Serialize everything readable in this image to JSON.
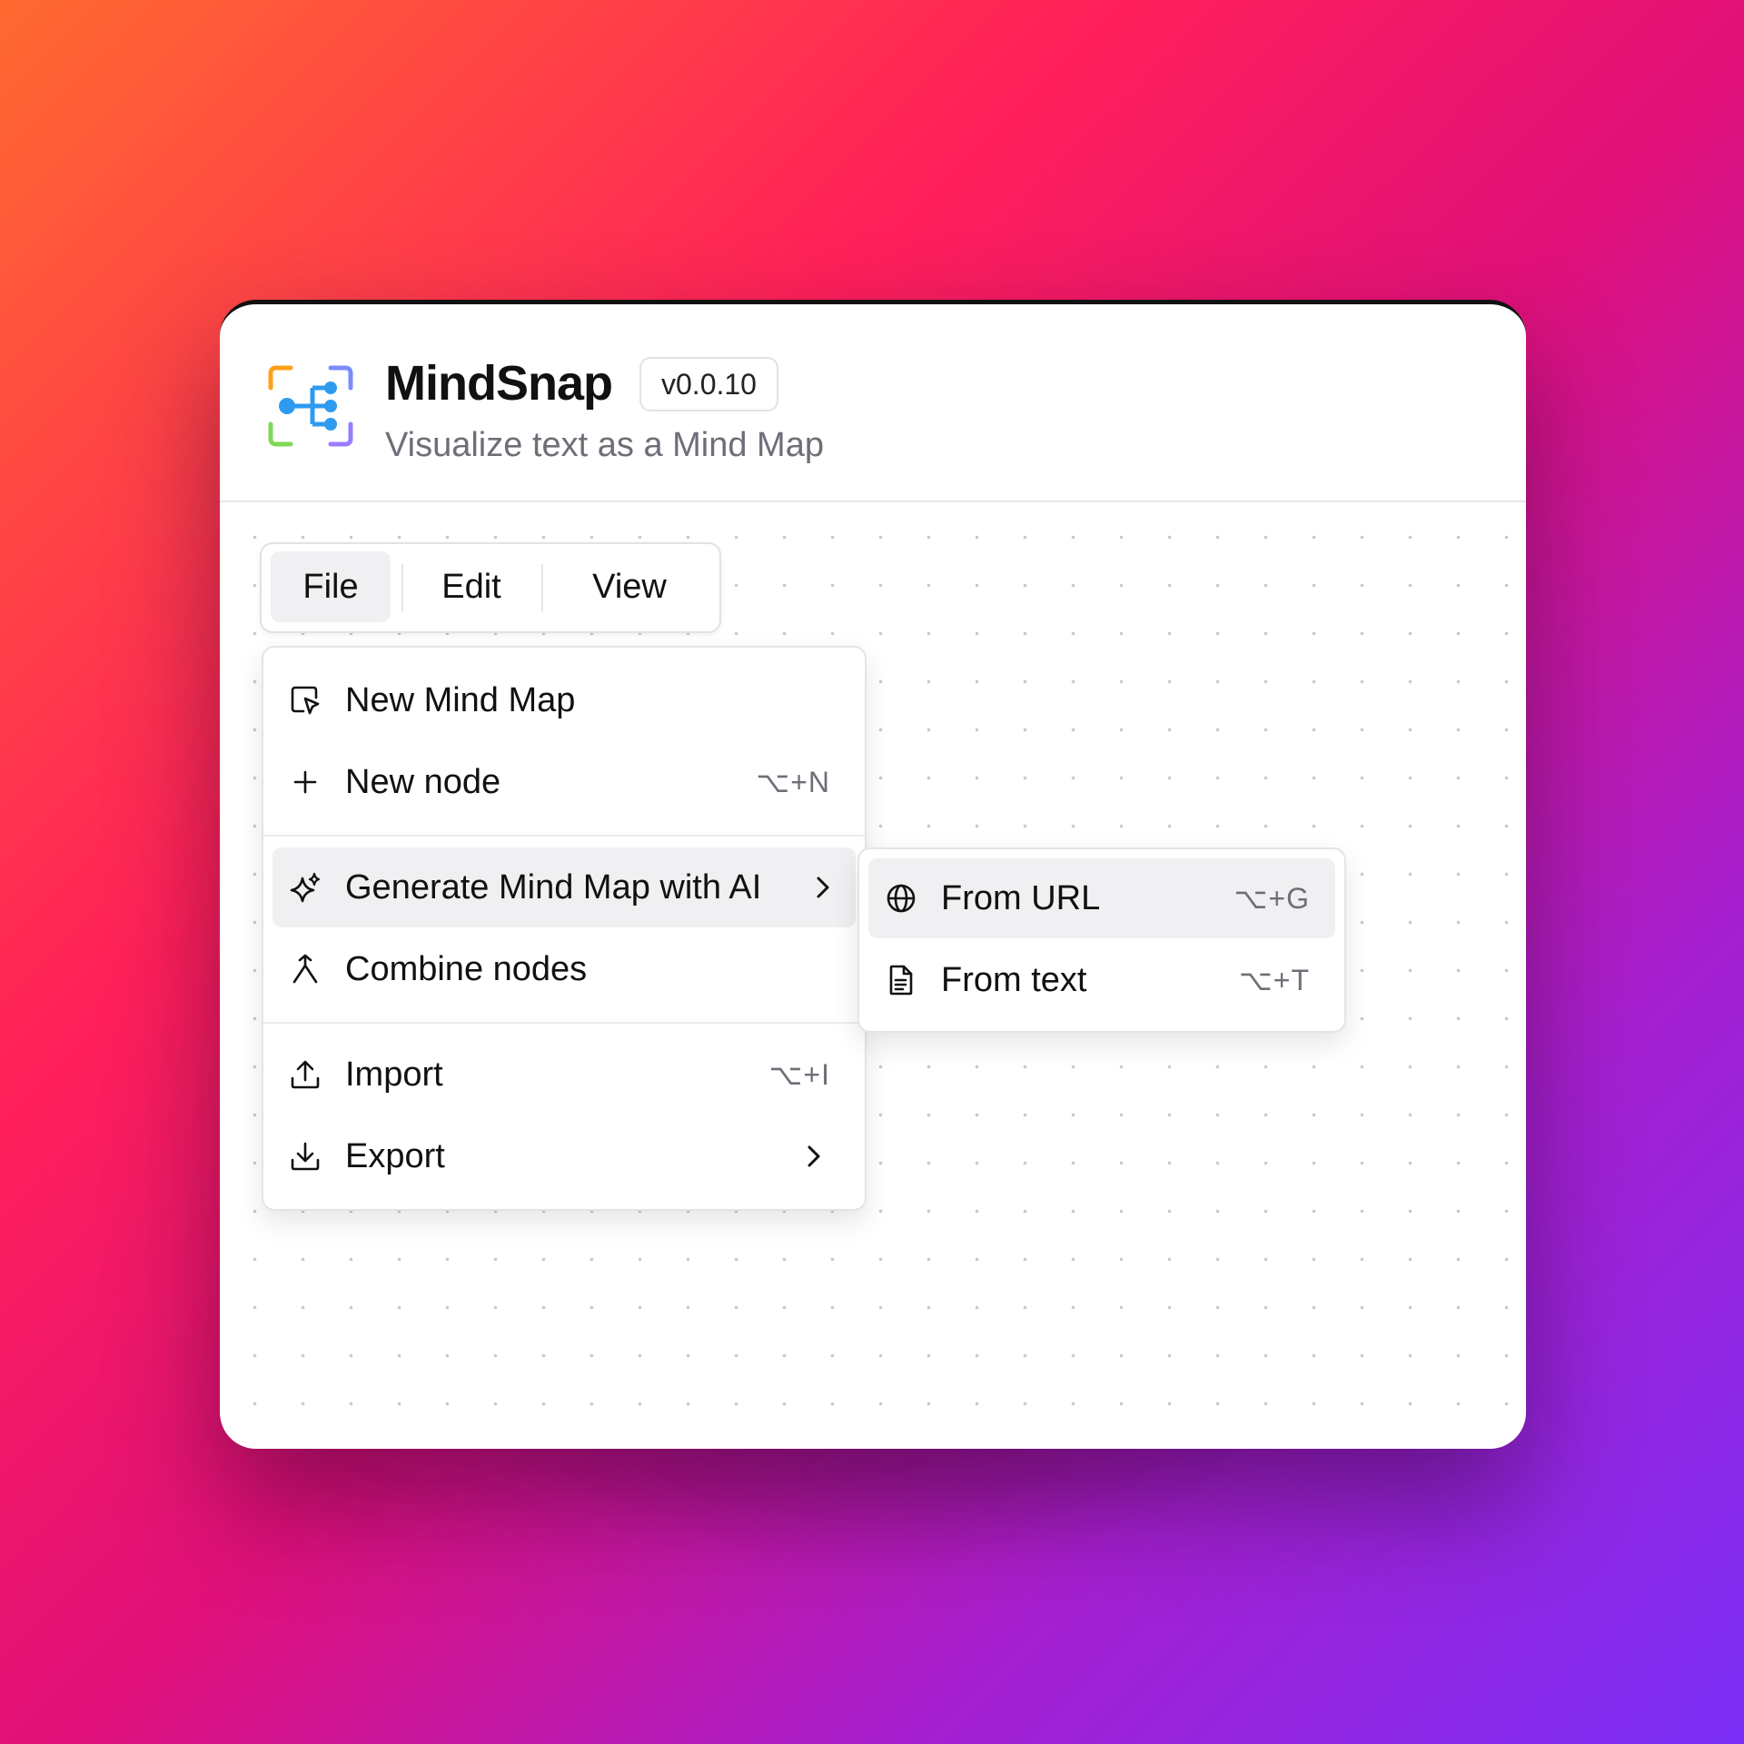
{
  "app": {
    "title": "MindSnap",
    "version": "v0.0.10",
    "subtitle": "Visualize text as a Mind Map"
  },
  "menubar": {
    "tabs": [
      {
        "label": "File",
        "active": true
      },
      {
        "label": "Edit",
        "active": false
      },
      {
        "label": "View",
        "active": false
      }
    ]
  },
  "file_menu": {
    "items": [
      {
        "label": "New Mind Map",
        "icon": "new-mind-map-icon",
        "shortcut": ""
      },
      {
        "label": "New node",
        "icon": "plus-icon",
        "shortcut": "⌥+N"
      },
      {
        "label": "Generate Mind Map with AI",
        "icon": "sparkles-icon",
        "shortcut": "",
        "submenu": true,
        "highlighted": true
      },
      {
        "label": "Combine nodes",
        "icon": "merge-icon",
        "shortcut": ""
      },
      {
        "label": "Import",
        "icon": "upload-icon",
        "shortcut": "⌥+I"
      },
      {
        "label": "Export",
        "icon": "download-icon",
        "shortcut": "",
        "submenu": true
      }
    ]
  },
  "ai_submenu": {
    "items": [
      {
        "label": "From URL",
        "icon": "globe-icon",
        "shortcut": "⌥+G",
        "highlighted": true
      },
      {
        "label": "From text",
        "icon": "document-icon",
        "shortcut": "⌥+T"
      }
    ]
  },
  "colors": {
    "logo_orange": "#ff9f1a",
    "logo_green": "#7ed957",
    "logo_purple": "#8a7cff",
    "logo_blue": "#2f9bef",
    "highlight": "#f0f0f2"
  }
}
